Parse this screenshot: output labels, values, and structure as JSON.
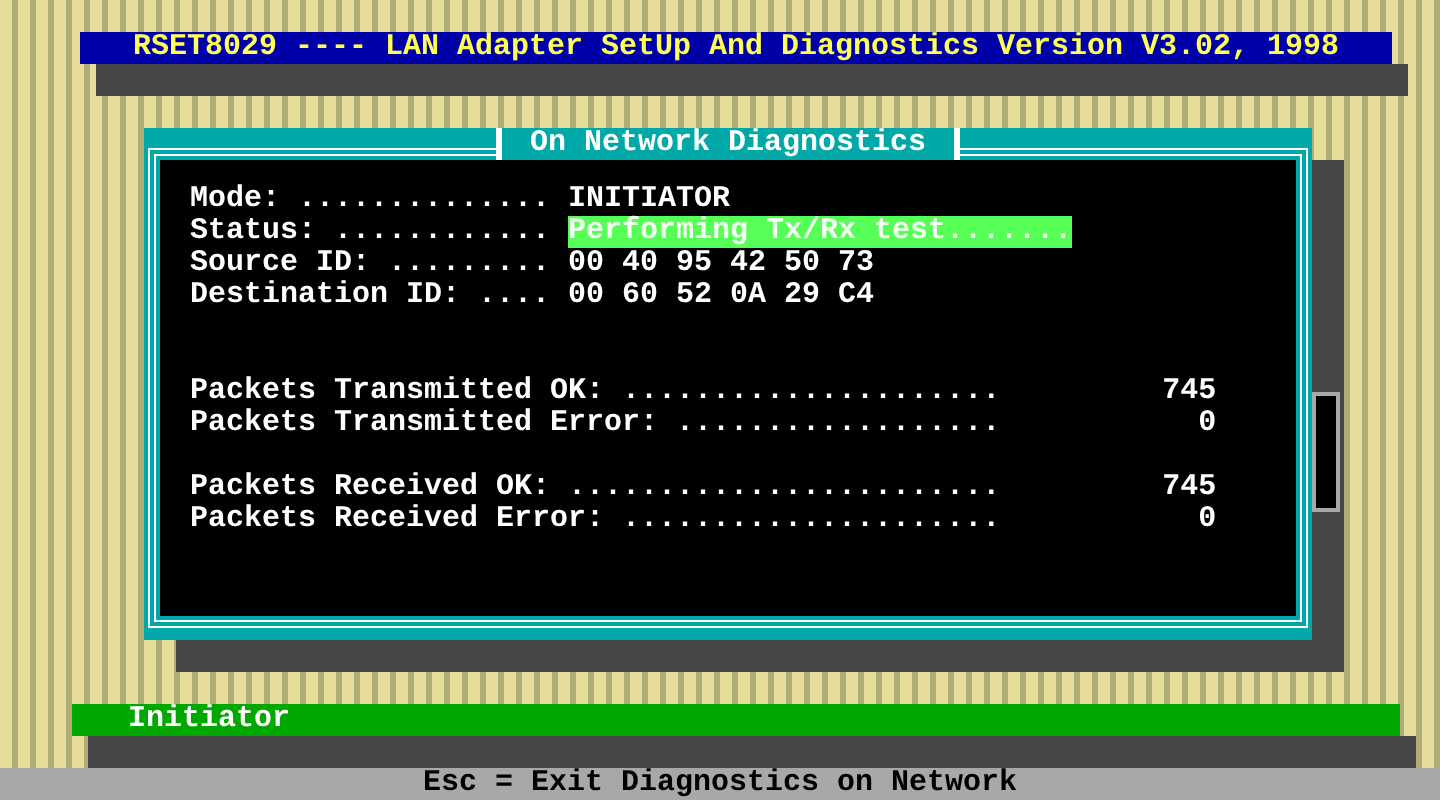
{
  "title_bar": {
    "title": "RSET8029 ---- LAN Adapter SetUp And Diagnostics Version V3.02, 1998"
  },
  "dialog": {
    "title": "On Network Diagnostics",
    "fields": [
      {
        "label": "Mode: ..............",
        "value": "INITIATOR",
        "highlighted": false
      },
      {
        "label": "Status: ............",
        "value": "Performing Tx/Rx test.......",
        "highlighted": true
      },
      {
        "label": "Source ID: .........",
        "value": "00 40 95 42 50 73",
        "highlighted": false
      },
      {
        "label": "Destination ID: ....",
        "value": "00 60 52 0A 29 C4",
        "highlighted": false
      }
    ],
    "counter_groups": [
      [
        {
          "label": "Packets Transmitted OK: .....................",
          "value": "745"
        },
        {
          "label": "Packets Transmitted Error: ..................",
          "value": "0"
        }
      ],
      [
        {
          "label": "Packets Received OK: ........................",
          "value": "745"
        },
        {
          "label": "Packets Received Error: .....................",
          "value": "0"
        }
      ]
    ]
  },
  "status_line": {
    "text": "Initiator"
  },
  "help_bar": {
    "text": "Esc = Exit Diagnostics on Network"
  }
}
